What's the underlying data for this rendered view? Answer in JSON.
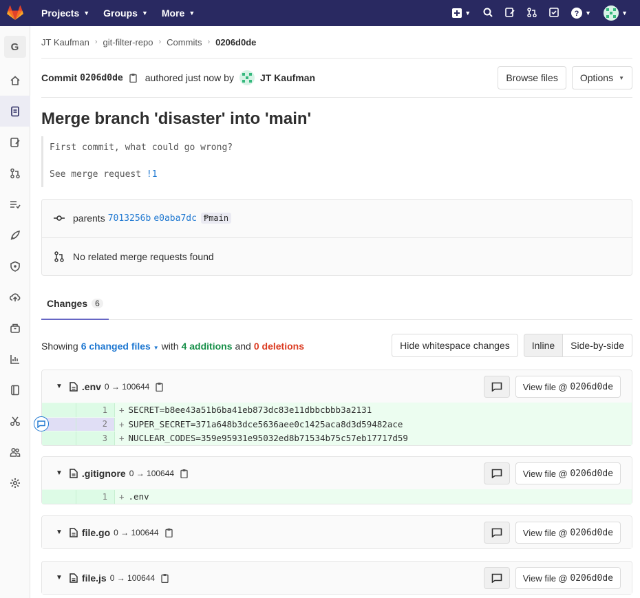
{
  "navbar": {
    "projects_label": "Projects",
    "groups_label": "Groups",
    "more_label": "More"
  },
  "sidebar": {
    "project_initial": "G"
  },
  "breadcrumb": {
    "items": [
      "JT Kaufman",
      "git-filter-repo",
      "Commits",
      "0206d0de"
    ]
  },
  "commit": {
    "label": "Commit",
    "short_sha": "0206d0de",
    "authored_text": "authored just now by",
    "author": "JT Kaufman",
    "browse_files_label": "Browse files",
    "options_label": "Options",
    "title": "Merge branch 'disaster' into 'main'",
    "description_line1": "First commit, what could go wrong?",
    "description_line2_prefix": "See merge request ",
    "description_mr_link": "!1",
    "parents_label": "parents",
    "parent1": "7013256b",
    "parent2": "e0aba7dc",
    "branch": "main",
    "related_mr_text": "No related merge requests found"
  },
  "tabs": {
    "changes_label": "Changes",
    "changes_count": "6"
  },
  "stats": {
    "showing": "Showing",
    "changed_files": "6 changed files",
    "with": "with",
    "additions": "4 additions",
    "and": "and",
    "deletions": "0 deletions",
    "hide_whitespace_label": "Hide whitespace changes",
    "inline_label": "Inline",
    "side_by_side_label": "Side-by-side"
  },
  "files": [
    {
      "name": ".env",
      "mode": "0 → 100644",
      "view_label": "View file @",
      "view_sha": "0206d0de",
      "lines": [
        {
          "num": "1",
          "code": "SECRET=b8ee43a51b6ba41eb873dc83e11dbbcbbb3a2131"
        },
        {
          "num": "2",
          "code": "SUPER_SECRET=371a648b3dce5636aee0c1425aca8d3d59482ace"
        },
        {
          "num": "3",
          "code": "NUCLEAR_CODES=359e95931e95032ed8b71534b75c57eb17717d59"
        }
      ]
    },
    {
      "name": ".gitignore",
      "mode": "0 → 100644",
      "view_label": "View file @",
      "view_sha": "0206d0de",
      "lines": [
        {
          "num": "1",
          "code": ".env"
        }
      ]
    },
    {
      "name": "file.go",
      "mode": "0 → 100644",
      "view_label": "View file @",
      "view_sha": "0206d0de",
      "lines": []
    },
    {
      "name": "file.js",
      "mode": "0 → 100644",
      "view_label": "View file @",
      "view_sha": "0206d0de",
      "lines": []
    }
  ],
  "colors": {
    "navbar": "#292961",
    "link": "#1f78d1",
    "addition": "#168f48",
    "deletion": "#db3b21",
    "tab_underline": "#6666c4"
  }
}
